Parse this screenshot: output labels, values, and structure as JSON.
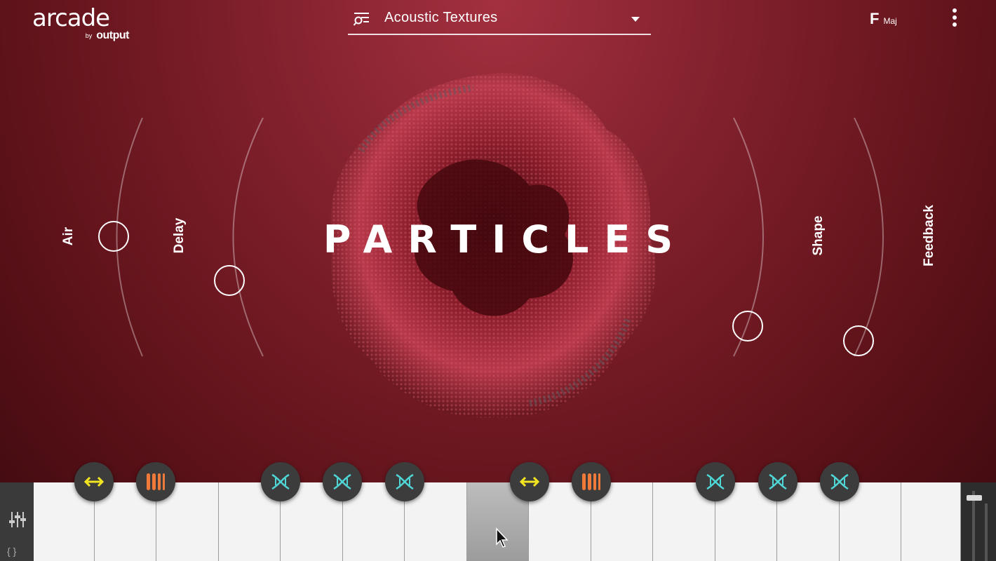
{
  "app": {
    "logo": "arcade",
    "logo_by": "by",
    "logo_brand": "output"
  },
  "preset": {
    "name": "Acoustic Textures"
  },
  "key": {
    "note": "F",
    "mode": "Maj"
  },
  "instrument": {
    "title": "PARTICLES"
  },
  "macros": {
    "air": "Air",
    "delay": "Delay",
    "shape": "Shape",
    "feedback": "Feedback"
  },
  "colors": {
    "accent_yellow": "#f3e421",
    "accent_orange": "#f07a3a",
    "accent_teal": "#4fd6d6",
    "background": "#7e1f2b"
  },
  "keyboard_buttons": [
    {
      "icon": "arrows-horizontal-icon"
    },
    {
      "icon": "bars-stutter-icon"
    },
    {
      "icon": "dna-icon"
    },
    {
      "icon": "dna-icon"
    },
    {
      "icon": "dna-icon"
    },
    {
      "icon": "arrows-horizontal-icon"
    },
    {
      "icon": "bars-stutter-icon"
    },
    {
      "icon": "dna-icon"
    },
    {
      "icon": "dna-icon"
    },
    {
      "icon": "dna-icon"
    }
  ]
}
